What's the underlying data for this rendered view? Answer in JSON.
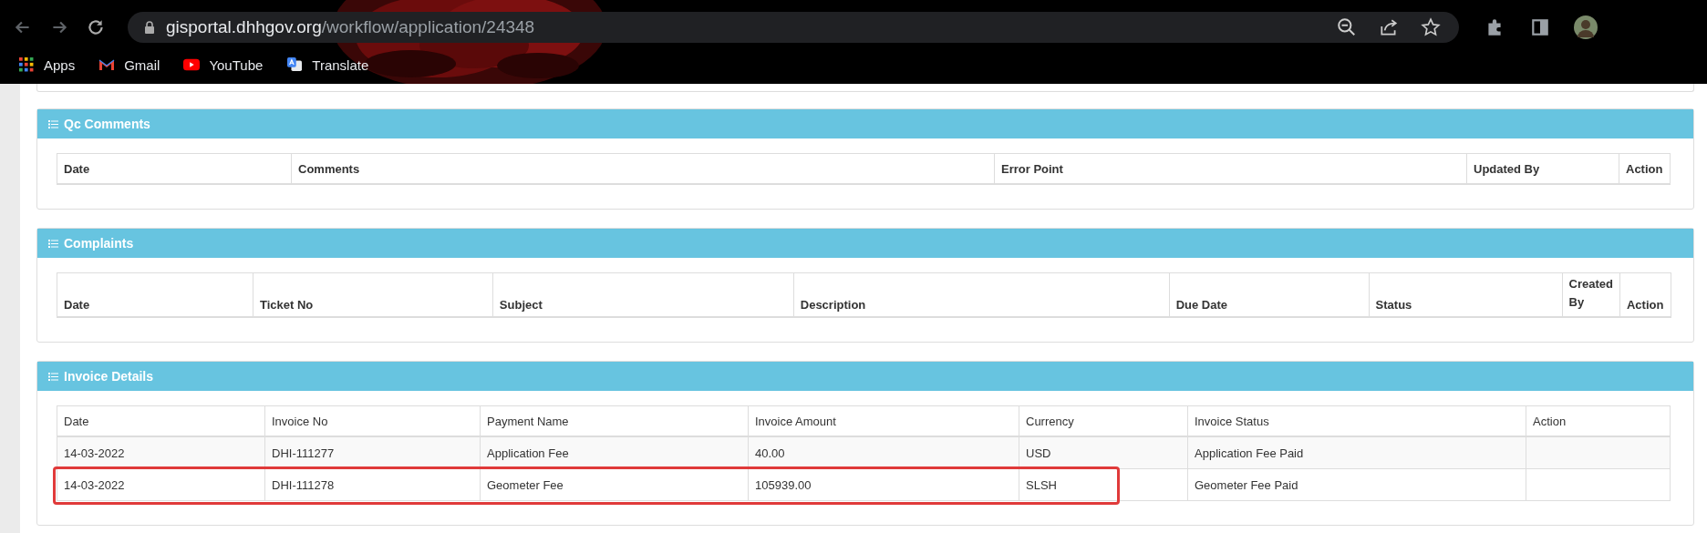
{
  "browser": {
    "url": {
      "host": "gisportal.dhhgov.org",
      "path": "/workflow/application/24348"
    },
    "bookmarks": [
      {
        "label": "Apps",
        "kind": "apps"
      },
      {
        "label": "Gmail",
        "kind": "gmail"
      },
      {
        "label": "YouTube",
        "kind": "youtube"
      },
      {
        "label": "Translate",
        "kind": "translate"
      }
    ]
  },
  "panels": [
    {
      "title": "Qc Comments",
      "columns": [
        "Date",
        "Comments",
        "Error Point",
        "Updated By",
        "Action"
      ]
    },
    {
      "title": "Complaints",
      "columns": [
        "Date",
        "Ticket No",
        "Subject",
        "Description",
        "Due Date",
        "Status",
        "Created By",
        "Action"
      ]
    },
    {
      "title": "Invoice Details",
      "columns": [
        "Date",
        "Invoice No",
        "Payment Name",
        "Invoice Amount",
        "Currency",
        "Invoice Status",
        "Action"
      ],
      "rows": [
        {
          "cells": [
            "14-03-2022",
            "DHI-111277",
            "Application Fee",
            "40.00",
            "USD",
            "Application Fee Paid",
            ""
          ],
          "highlighted": false
        },
        {
          "cells": [
            "14-03-2022",
            "DHI-111278",
            "Geometer Fee",
            "105939.00",
            "SLSH",
            "Geometer Fee Paid",
            ""
          ],
          "highlighted": true
        }
      ]
    }
  ]
}
